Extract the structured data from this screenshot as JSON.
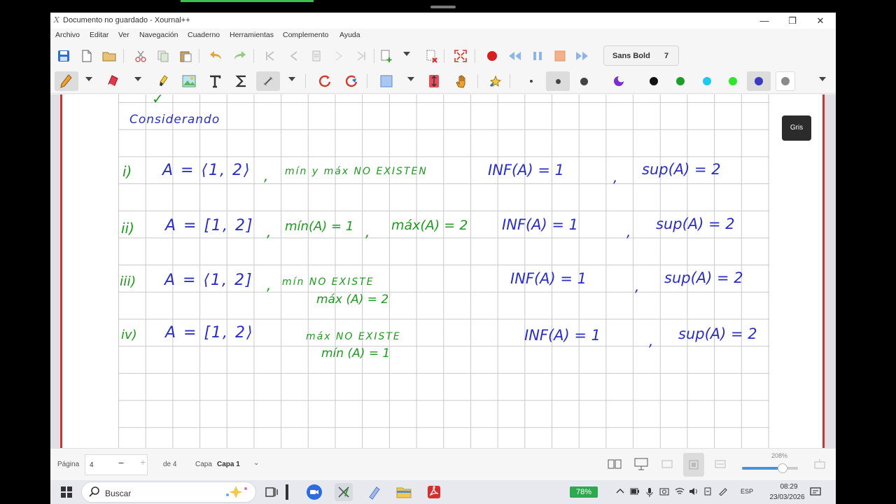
{
  "window": {
    "title": "Documento no guardado - Xournal++",
    "app_icon_glyph": "X",
    "minimize": "—",
    "maximize": "❐",
    "close": "✕"
  },
  "menu": [
    "Archivo",
    "Editar",
    "Ver",
    "Navegación",
    "Cuaderno",
    "Herramientas",
    "Complemento",
    "Ayuda"
  ],
  "toolbar": {
    "font_name": "Sans Bold",
    "font_size": "7",
    "colors": {
      "black": "#111111",
      "green": "#1f9d2a",
      "cyan": "#1ec8ef",
      "light_green": "#2ee62e",
      "blue": "#3b3bc0",
      "gray": "#8a8a8a",
      "record": "#d61f1f",
      "magenta": "#7b2fd0",
      "accent": "#3a7bd5"
    }
  },
  "tooltip": "Gris",
  "notes": {
    "heading": "Considerando",
    "l1_label": "i)",
    "l1_set": "A = ⟨1, 2⟩",
    "l1_comma1": ",",
    "l1_green": "mín y máx NO EXISTEN",
    "l1_inf": "INF(A) = 1",
    "l1_comma2": ",",
    "l1_sup": "sup(A) = 2",
    "l2_label": "ii)",
    "l2_set": "A = [1, 2]",
    "l2_comma1": ",",
    "l2_min": "mín(A) = 1",
    "l2_comma2": ",",
    "l2_max": "máx(A) = 2",
    "l2_inf": "INF(A) = 1",
    "l2_comma3": ",",
    "l2_sup": "sup(A) = 2",
    "l3_label": "iii)",
    "l3_set": "A = ⟨1, 2]",
    "l3_comma1": ",",
    "l3_green": "mín NO EXISTE",
    "l3_max": "máx (A) = 2",
    "l3_inf": "INF(A) = 1",
    "l3_comma2": ",",
    "l3_sup": "sup(A) = 2",
    "l4_label": "iv)",
    "l4_set": "A = [1, 2⟩",
    "l4_green": "máx NO EXISTE",
    "l4_min": "mín (A) = 1",
    "l4_inf": "INF(A) = 1",
    "l4_comma": ",",
    "l4_sup": "sup(A) = 2"
  },
  "status": {
    "page_label": "Página",
    "page_value": "4",
    "page_minus": "−",
    "page_plus": "+",
    "of_pages": "de 4",
    "layer_label": "Capa",
    "layer_value": "Capa 1",
    "layer_chevron": "⌄",
    "zoom": "208%",
    "zoom_fraction": 0.72
  },
  "taskbar": {
    "search_placeholder": "Buscar",
    "battery": "78%",
    "lang": "ESP",
    "time": "08:29",
    "date": "23/03/2026"
  }
}
